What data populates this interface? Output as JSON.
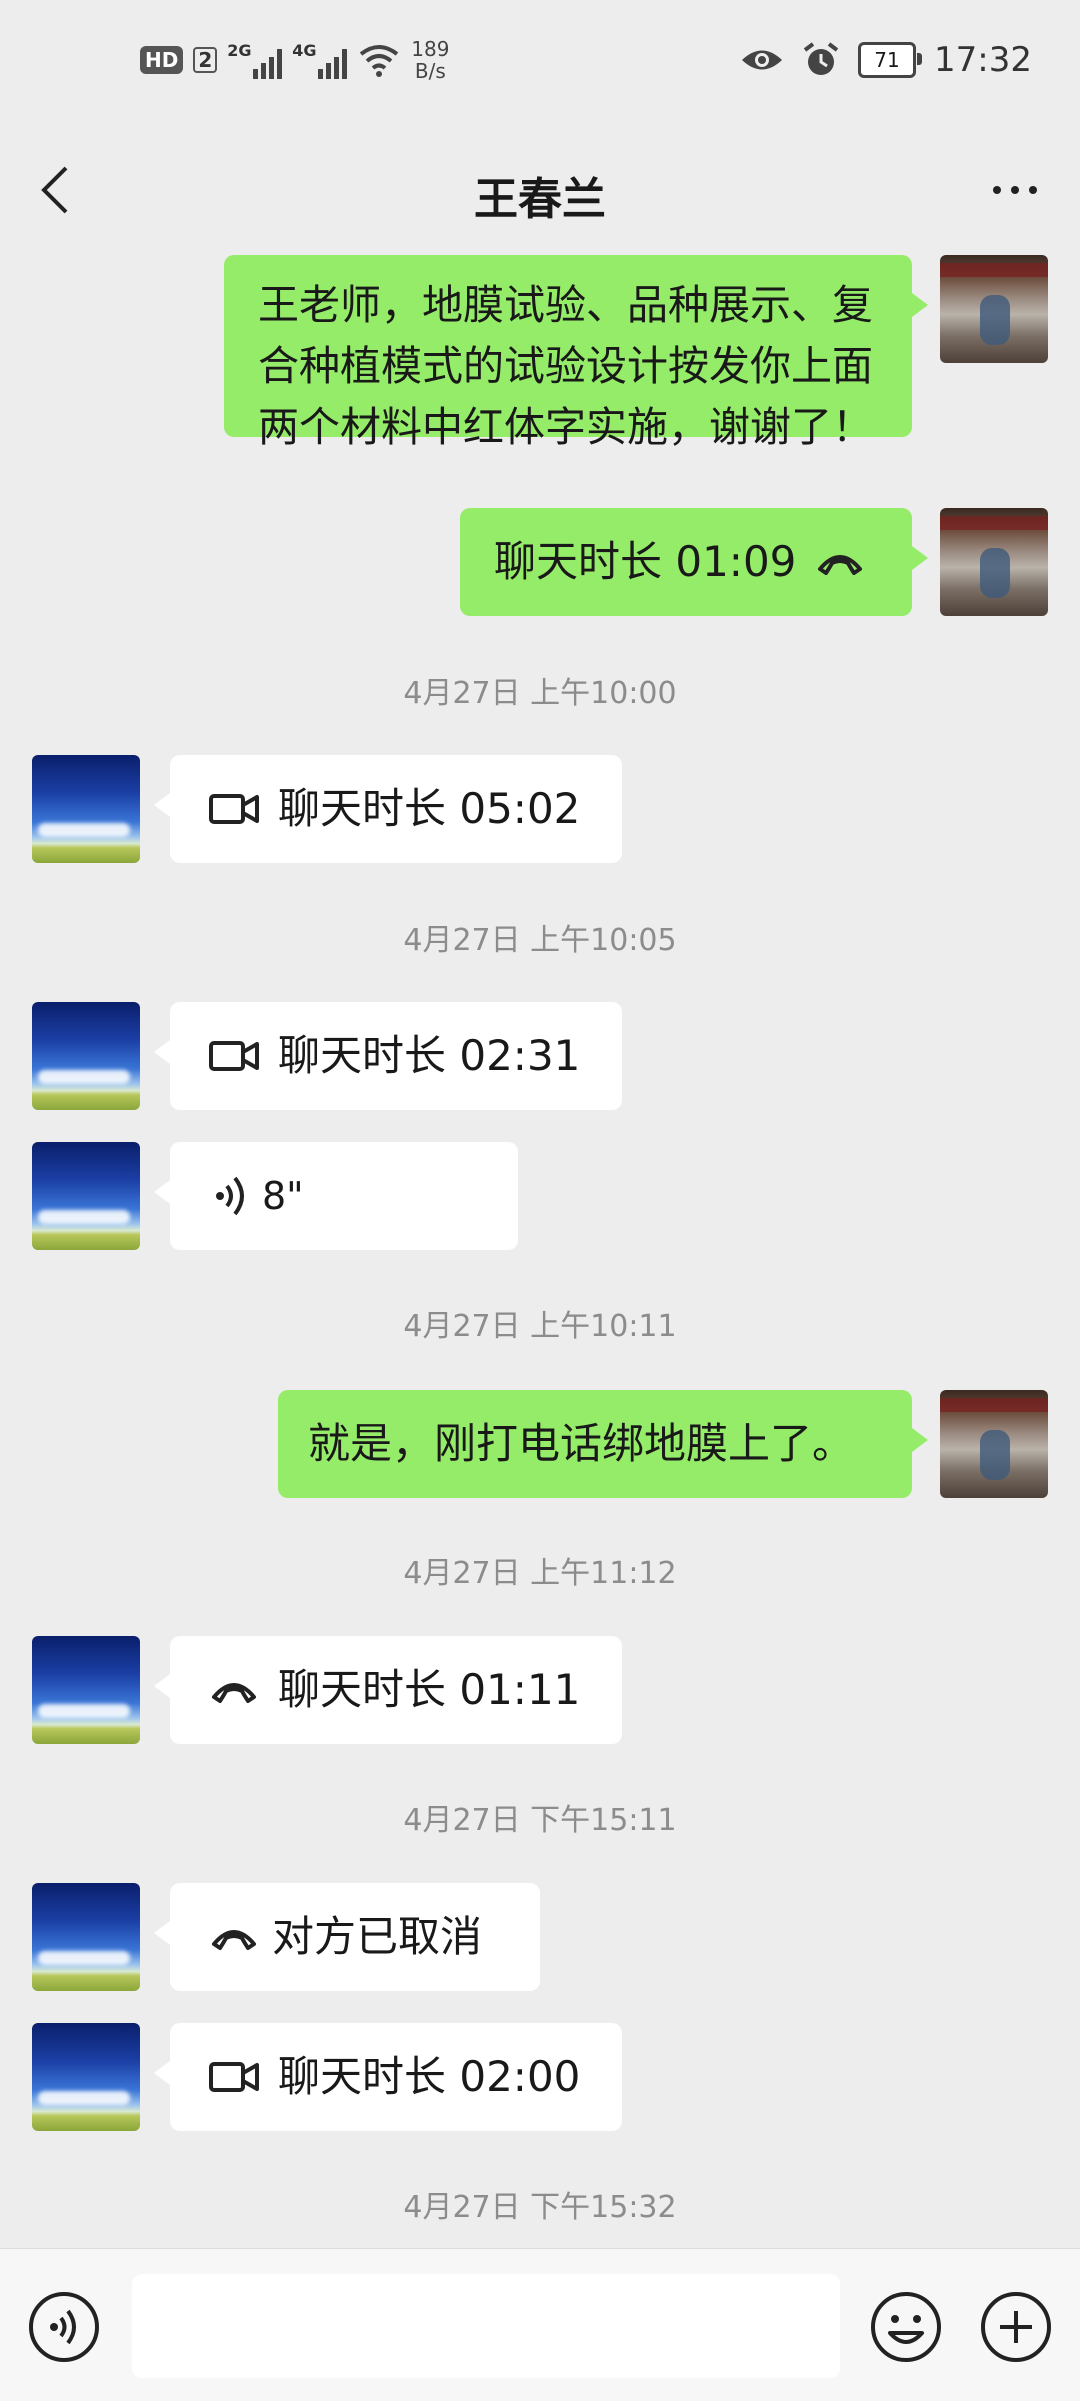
{
  "status_bar": {
    "hd": "HD",
    "sim": "2",
    "net1": "2G",
    "net2": "4G",
    "speed_value": "189",
    "speed_unit": "B/s",
    "battery": "71",
    "time": "17:32",
    "icons": [
      "eye-icon",
      "alarm-icon",
      "battery-icon",
      "wifi-icon"
    ]
  },
  "header": {
    "title": "王春兰"
  },
  "messages": {
    "m1": {
      "sender": "self",
      "text": "王老师，地膜试验、品种展示、复合种植模式的试验设计按发你上面两个材料中红体字实施，谢谢了！"
    },
    "m2": {
      "sender": "self",
      "text": "聊天时长 01:09",
      "icon": "phone-icon"
    },
    "t1": "4月27日 上午10:00",
    "m3": {
      "sender": "other",
      "text": "聊天时长 05:02",
      "icon": "video-icon"
    },
    "t2": "4月27日 上午10:05",
    "m4": {
      "sender": "other",
      "text": "聊天时长 02:31",
      "icon": "video-icon"
    },
    "m5": {
      "sender": "other",
      "text": "8\"",
      "icon": "voice-wave-icon"
    },
    "t3": "4月27日 上午10:11",
    "m6": {
      "sender": "self",
      "text": "就是，刚打电话绑地膜上了。"
    },
    "t4": "4月27日 上午11:12",
    "m7": {
      "sender": "other",
      "text": "聊天时长 01:11",
      "icon": "phone-icon"
    },
    "t5": "4月27日 下午15:11",
    "m8": {
      "sender": "other",
      "text": "对方已取消",
      "icon": "phone-icon"
    },
    "m9": {
      "sender": "other",
      "text": "聊天时长 02:00",
      "icon": "video-icon"
    },
    "t6": "4月27日 下午15:32"
  },
  "input_bar": {
    "value": "",
    "placeholder": ""
  },
  "colors": {
    "background": "#ededed",
    "self_bubble": "#95ec69",
    "other_bubble": "#ffffff",
    "timestamp": "#8c8c8c"
  }
}
